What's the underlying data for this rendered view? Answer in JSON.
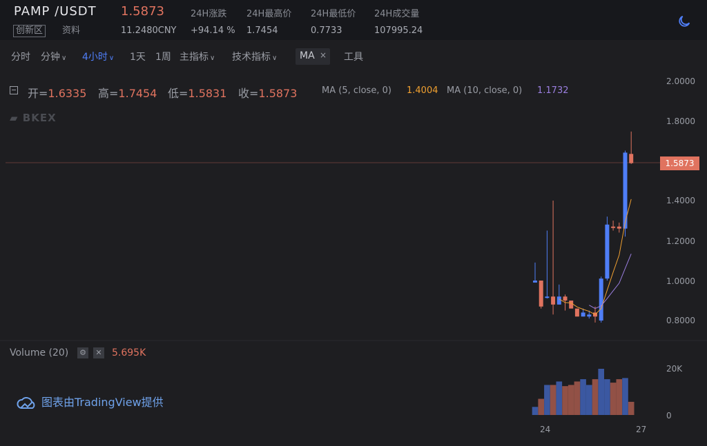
{
  "header": {
    "pair": "PAMP /USDT",
    "last_price": "1.5873",
    "board_tag": "创新区",
    "info_link": "资料",
    "stats": [
      {
        "label": "24H涨跌",
        "value": "11.2480CNY"
      },
      {
        "label": "24H最高价",
        "value": "+94.14 %"
      },
      {
        "label": "24H最低价",
        "value": "1.7454"
      },
      {
        "label": "24H成交量",
        "value": "0.7733"
      },
      {
        "label": "",
        "value": "107995.24"
      }
    ],
    "theme_icon": "moon-icon"
  },
  "toolbar": {
    "items": [
      "分时",
      "分钟",
      "4小时",
      "1天",
      "1周",
      "主指标",
      "技术指标",
      "工具"
    ],
    "active": "4小时",
    "ma_chip": "MA",
    "ma_chip_close": "×"
  },
  "legend": {
    "open_label": "开=",
    "open": "1.6335",
    "high_label": "高=",
    "high": "1.7454",
    "low_label": "低=",
    "low": "1.5831",
    "close_label": "收=",
    "close": "1.5873",
    "ma5_label": "MA (5, close, 0)",
    "ma5": "1.4004",
    "ma10_label": "MA (10, close, 0)",
    "ma10": "1.1732"
  },
  "watermark": "BKEX",
  "volume": {
    "title": "Volume (20)",
    "value": "5.695K",
    "axis": [
      "20K",
      "0"
    ]
  },
  "credit": "图表由TradingView提供",
  "colors": {
    "up": "#e0735f",
    "down": "#4f7ef7",
    "ma5": "#f0a030",
    "ma10": "#9b7fe0",
    "bg": "#1e1e21"
  },
  "chart_data": {
    "type": "candlestick",
    "y_ticks": [
      "2.0000",
      "1.8000",
      "1.6000",
      "1.4000",
      "1.2000",
      "1.0000",
      "0.8000"
    ],
    "price_ylim": [
      0.75,
      2.0
    ],
    "volume_ylim": [
      0,
      20000
    ],
    "x_ticks": [
      "24",
      "27"
    ],
    "last_price": "1.5873",
    "candles": [
      {
        "o": 1.0,
        "h": 1.09,
        "l": 0.99,
        "c": 0.99,
        "v": 3500,
        "d": "down"
      },
      {
        "o": 1.0,
        "h": 1.0,
        "l": 0.86,
        "c": 0.87,
        "v": 7000,
        "d": "up"
      },
      {
        "o": 0.92,
        "h": 1.25,
        "l": 0.91,
        "c": 0.92,
        "v": 13000,
        "d": "down"
      },
      {
        "o": 0.92,
        "h": 1.4,
        "l": 0.83,
        "c": 0.88,
        "v": 13000,
        "d": "up"
      },
      {
        "o": 0.92,
        "h": 0.98,
        "l": 0.88,
        "c": 0.88,
        "v": 14500,
        "d": "down"
      },
      {
        "o": 0.92,
        "h": 0.93,
        "l": 0.85,
        "c": 0.9,
        "v": 12500,
        "d": "up"
      },
      {
        "o": 0.9,
        "h": 0.9,
        "l": 0.86,
        "c": 0.86,
        "v": 13000,
        "d": "up"
      },
      {
        "o": 0.86,
        "h": 0.86,
        "l": 0.82,
        "c": 0.82,
        "v": 14500,
        "d": "up"
      },
      {
        "o": 0.84,
        "h": 0.86,
        "l": 0.82,
        "c": 0.82,
        "v": 15500,
        "d": "down"
      },
      {
        "o": 0.82,
        "h": 0.85,
        "l": 0.81,
        "c": 0.83,
        "v": 13000,
        "d": "down"
      },
      {
        "o": 0.84,
        "h": 0.87,
        "l": 0.79,
        "c": 0.82,
        "v": 15500,
        "d": "up"
      },
      {
        "o": 0.8,
        "h": 1.02,
        "l": 0.79,
        "c": 1.01,
        "v": 20000,
        "d": "down"
      },
      {
        "o": 1.01,
        "h": 1.32,
        "l": 1.0,
        "c": 1.28,
        "v": 15500,
        "d": "down"
      },
      {
        "o": 1.27,
        "h": 1.3,
        "l": 1.25,
        "c": 1.27,
        "v": 14000,
        "d": "up"
      },
      {
        "o": 1.27,
        "h": 1.29,
        "l": 1.24,
        "c": 1.26,
        "v": 15500,
        "d": "up"
      },
      {
        "o": 1.26,
        "h": 1.65,
        "l": 1.22,
        "c": 1.64,
        "v": 16000,
        "d": "down"
      },
      {
        "o": 1.6335,
        "h": 1.7454,
        "l": 1.5831,
        "c": 1.5873,
        "v": 5695,
        "d": "up"
      }
    ]
  }
}
